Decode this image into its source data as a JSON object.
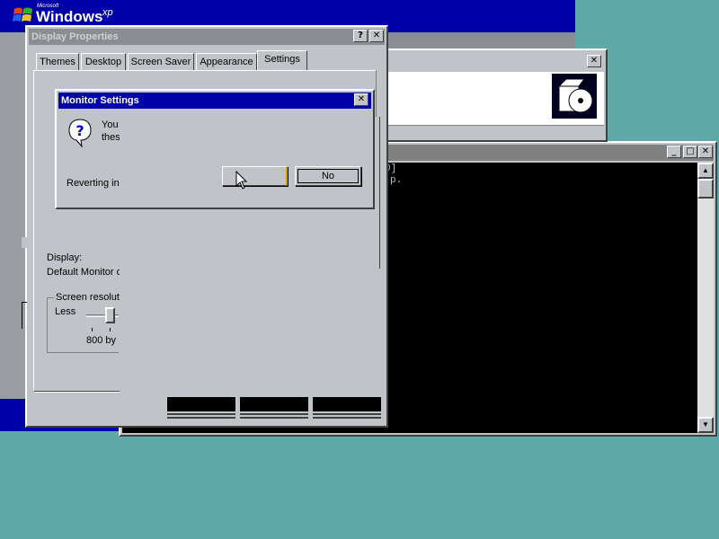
{
  "desktop": {
    "logo_small": "Microsoft",
    "logo_main": "Windows",
    "logo_suffix": "xp"
  },
  "display_properties": {
    "title": "Display Properties",
    "help_btn": "?",
    "close_btn": "✕",
    "tabs": [
      {
        "label": "Themes"
      },
      {
        "label": "Desktop"
      },
      {
        "label": "Screen Saver"
      },
      {
        "label": "Appearance"
      },
      {
        "label": "Settings"
      }
    ],
    "display_label": "Display:",
    "display_value": "Default Monitor o",
    "resolution_group": "Screen resoluti",
    "less_label": "Less",
    "resolution_value": "800 by"
  },
  "installer_window": {
    "close_btn": "✕",
    "icon": "cd-box-icon"
  },
  "console_window": {
    "minimize_btn": "_",
    "maximize_btn": "□",
    "close_btn": "✕",
    "lines": [
      "0]",
      "p."
    ]
  },
  "monitor_settings": {
    "title": "Monitor Settings",
    "close_btn": "✕",
    "message_line1": "You",
    "message_line2": "thes",
    "reverting": "Reverting in",
    "yes_label": "",
    "no_label": "No"
  }
}
